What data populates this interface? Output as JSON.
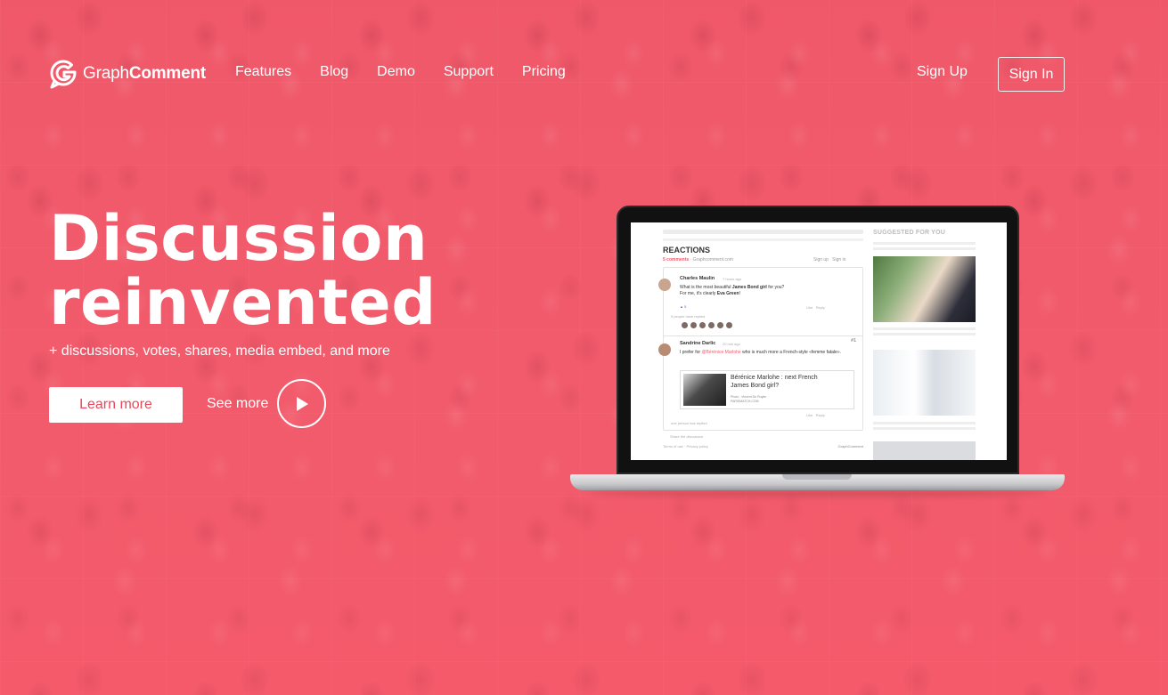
{
  "brand": {
    "light": "Graph",
    "bold": "Comment",
    "accent": "#f15a6b"
  },
  "nav": {
    "items": [
      "Features",
      "Blog",
      "Demo",
      "Support",
      "Pricing"
    ],
    "signup": "Sign Up",
    "signin": "Sign In"
  },
  "hero": {
    "title_line1": "Discussion",
    "title_line2": "reinvented",
    "subtitle": "+ discussions, votes, shares, media embed, and more",
    "learn_more": "Learn more",
    "see_more": "See more"
  },
  "screen": {
    "reactions": "REACTIONS",
    "comment_count": "5 comments",
    "site": "Graphcomment.com",
    "sign_up": "Sign up",
    "sign_in": "Sign in",
    "comment1": {
      "author": "Charles Maulin",
      "time": "7 hours ago",
      "text_a": "What is the most beautiful ",
      "text_b": "James Bond girl",
      "text_c": " for you?",
      "text_d": "For me, it's clearly ",
      "text_e": "Eva Green",
      "text_f": "!",
      "votes": "5",
      "like": "Like",
      "reply": "Reply",
      "replied": "5 people have replied"
    },
    "comment2": {
      "author": "Sandrine Darlic",
      "time": "20 min ago",
      "number": "#1",
      "text_a": "I prefer for ",
      "text_mention": "@Bérénice Marlohe",
      "text_b": " who is much more a French-style «femme fatale».",
      "embed_title": "Bérénice Marlohe : next French James Bond girl?",
      "embed_credit": "Photo : Vincent De Ruyter",
      "embed_source": "PARISMATCH.COM",
      "like": "Like",
      "reply": "Reply",
      "replied": "one person has replied"
    },
    "share": "Share the discussion",
    "footer_left": "Terms of use · Privacy policy",
    "footer_right": "GraphComment",
    "suggested": "SUGGESTED FOR YOU"
  }
}
